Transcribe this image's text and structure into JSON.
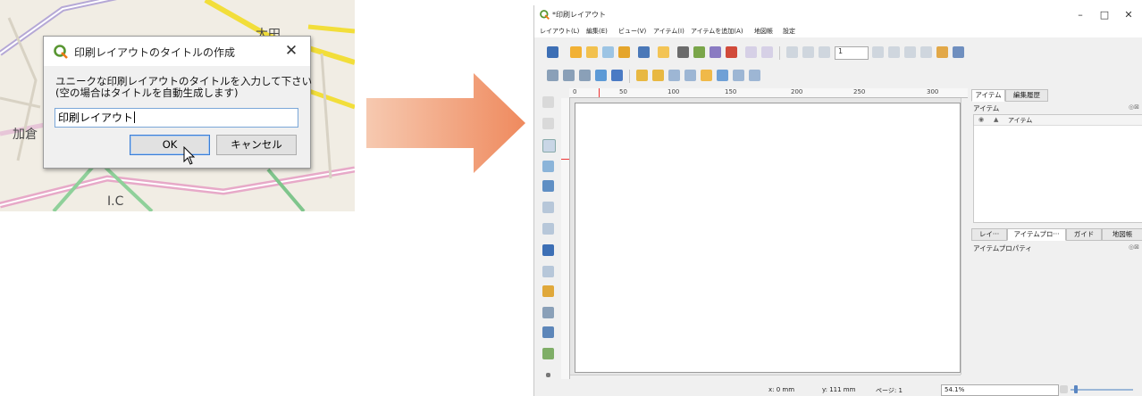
{
  "dialog": {
    "title": "印刷レイアウトのタイトルの作成",
    "close_glyph": "✕",
    "message": "ユニークな印刷レイアウトのタイトルを入力して下さい\n(空の場合はタイトルを自動生成します)",
    "input_value": "印刷レイアウト",
    "ok_label": "OK",
    "cancel_label": "キャンセル"
  },
  "map": {
    "labels": [
      "加倉",
      "太田",
      "I.C"
    ]
  },
  "window": {
    "title": "*印刷レイアウト",
    "controls": {
      "minimize": "–",
      "maximize": "□",
      "close": "✕"
    },
    "menus": [
      "レイアウト(L)",
      "編集(E)",
      "ビュー(V)",
      "アイテム(I)",
      "アイテムを追加(A)",
      "地図帳",
      "設定"
    ],
    "page_spin_value": "1",
    "ruler_labels": [
      "0",
      "50",
      "100",
      "150",
      "200",
      "250",
      "300"
    ],
    "panel_top": {
      "tabs": [
        "アイテム",
        "編集履歴"
      ],
      "heading": "アイテム",
      "column_header": "アイテム"
    },
    "panel_bottom": {
      "tabs": [
        "レイ···",
        "アイテムプロ···",
        "ガイド",
        "地図帳"
      ],
      "heading": "アイテムプロパティ"
    },
    "status": {
      "x": "x: 0 mm",
      "y": "y: 111 mm",
      "page": "ページ: 1",
      "zoom": "54.1%"
    }
  },
  "colors": {
    "qgis_green": "#589632",
    "arrow_start": "#f6c9b0",
    "arrow_end": "#ef8a5e",
    "accent_blue": "#3c7fd6"
  }
}
